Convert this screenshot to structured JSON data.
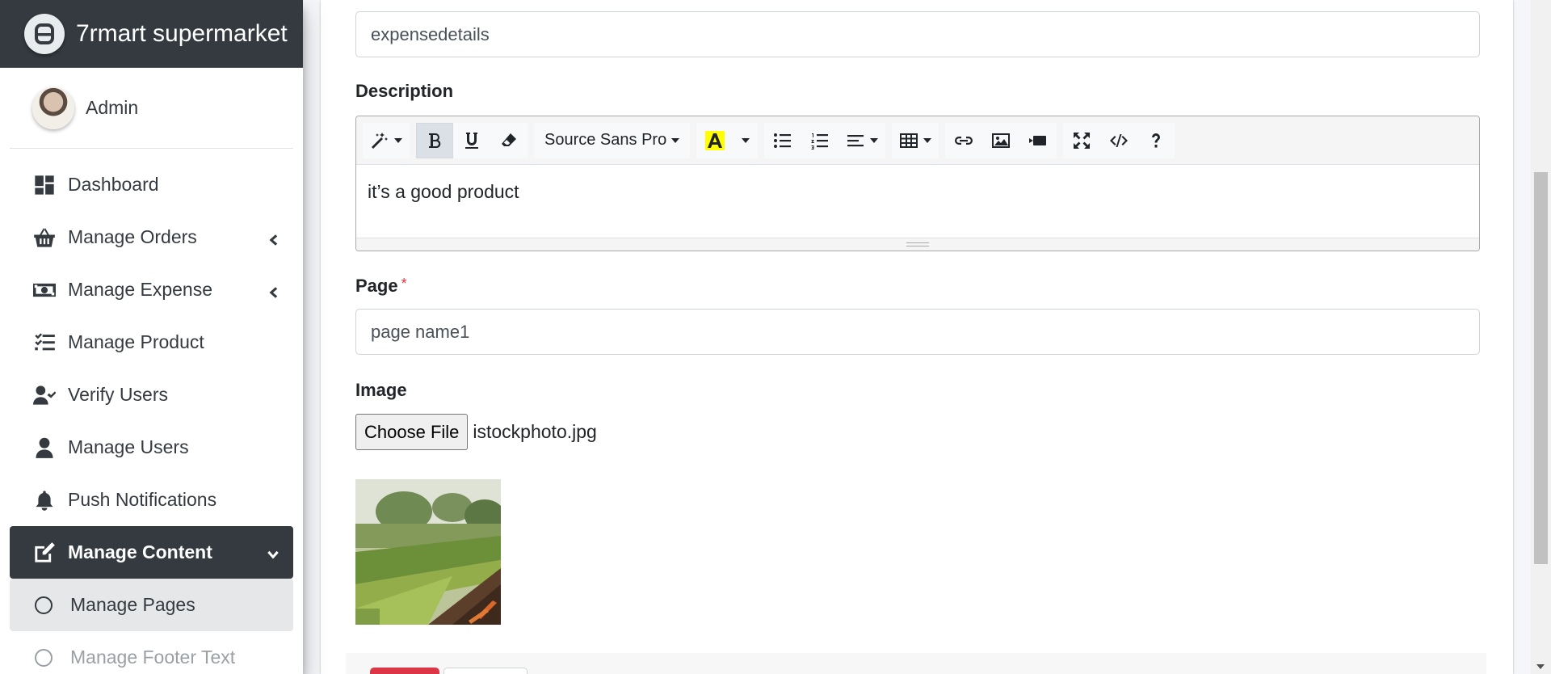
{
  "brand": {
    "name": "7rmart supermarket"
  },
  "user": {
    "name": "Admin"
  },
  "sidebar": {
    "items": [
      {
        "label": "Dashboard",
        "icon": "dashboard-icon"
      },
      {
        "label": "Manage Orders",
        "icon": "basket-icon",
        "expandable": true
      },
      {
        "label": "Manage Expense",
        "icon": "money-bill-icon",
        "expandable": true
      },
      {
        "label": "Manage Product",
        "icon": "tasks-list-icon"
      },
      {
        "label": "Verify Users",
        "icon": "user-check-icon"
      },
      {
        "label": "Manage Users",
        "icon": "user-icon"
      },
      {
        "label": "Push Notifications",
        "icon": "bell-icon"
      },
      {
        "label": "Manage Content",
        "icon": "edit-icon",
        "expanded": true
      },
      {
        "label": "Manage Pages",
        "icon": "circle-icon",
        "selected": true
      },
      {
        "label": "Manage Footer Text",
        "icon": "circle-icon"
      }
    ]
  },
  "form": {
    "title_value": "expensedetails",
    "description_label": "Description",
    "description_text": "it’s a good product",
    "font_name": "Source Sans Pro",
    "page_label": "Page",
    "page_required_mark": "*",
    "page_value": "page name1",
    "image_label": "Image",
    "choose_file_label": "Choose File",
    "file_name": "istockphoto.jpg"
  },
  "colors": {
    "sidebar_dark": "#343a40",
    "danger": "#dc3545",
    "highlight_yellow": "#ffff00"
  }
}
